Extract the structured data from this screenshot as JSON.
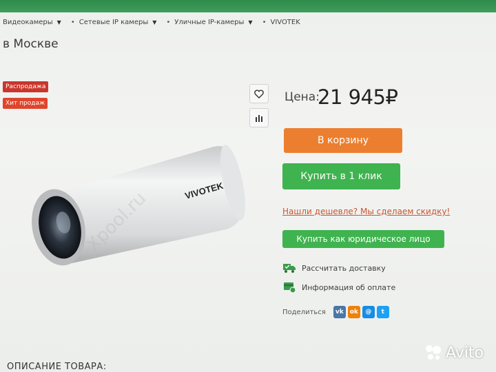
{
  "breadcrumbs": [
    {
      "label": "Видеокамеры"
    },
    {
      "label": "Сетевые IP камеры"
    },
    {
      "label": "Уличные IP-камеры"
    },
    {
      "label": "VIVOTEK"
    }
  ],
  "page_title": "в Москве",
  "badges": {
    "sale": "Распродажа",
    "hit": "Хит продаж"
  },
  "icons": {
    "favorite": "heart-icon",
    "compare": "bar-chart-icon",
    "delivery": "truck-icon",
    "payment": "card-icon"
  },
  "product": {
    "brand": "VIVOTEK",
    "watermark": "Xpool.ru"
  },
  "price": {
    "label": "Цена:",
    "value": "21 945",
    "currency": "₽"
  },
  "buttons": {
    "cart": "В корзину",
    "one_click": "Купить в 1 клик",
    "cheaper": "Нашли дешевле? Мы сделаем скидку!",
    "legal": "Купить как юридическое лицо"
  },
  "info": {
    "delivery": "Рассчитать доставку",
    "payment": "Информация об оплате"
  },
  "share": {
    "label": "Поделиться",
    "networks": [
      "vk",
      "ok",
      "mm",
      "twitter"
    ]
  },
  "description_title": "ОПИСАНИЕ ТОВАРА:",
  "avito": "Avito",
  "colors": {
    "orange": "#ec7f2f",
    "green": "#3fb34f",
    "red": "#c9362c"
  }
}
